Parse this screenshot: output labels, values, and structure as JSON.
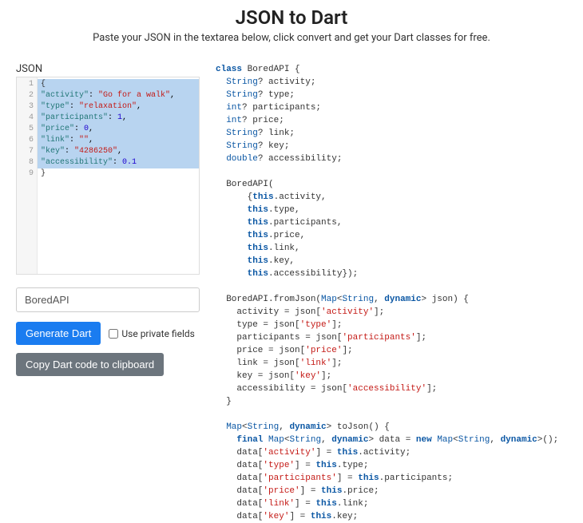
{
  "header": {
    "title": "JSON to Dart",
    "subtitle": "Paste your JSON in the textarea below, click convert and get your Dart classes for free."
  },
  "left": {
    "json_label": "JSON",
    "classname_value": "BoredAPI",
    "generate_button": "Generate Dart",
    "private_checkbox_label": "Use private fields",
    "copy_button": "Copy Dart code to clipboard",
    "editor_lines": [
      "1",
      "2",
      "3",
      "4",
      "5",
      "6",
      "7",
      "8",
      "9"
    ],
    "json_content": {
      "l1": "{",
      "l2_k": "\"activity\"",
      "l2_v": "\"Go for a walk\"",
      "l3_k": "\"type\"",
      "l3_v": "\"relaxation\"",
      "l4_k": "\"participants\"",
      "l4_v": "1",
      "l5_k": "\"price\"",
      "l5_v": "0",
      "l6_k": "\"link\"",
      "l6_v": "\"\"",
      "l7_k": "\"key\"",
      "l7_v": "\"4286250\"",
      "l8_k": "\"accessibility\"",
      "l8_v": "0.1",
      "l9": "}"
    }
  },
  "dart": {
    "class_kw": "class",
    "class_name": "BoredAPI",
    "decl1_t": "String",
    "decl1_n": "? activity;",
    "decl2_t": "String",
    "decl2_n": "? type;",
    "decl3_t": "int",
    "decl3_n": "? participants;",
    "decl4_t": "int",
    "decl4_n": "? price;",
    "decl5_t": "String",
    "decl5_n": "? link;",
    "decl6_t": "String",
    "decl6_n": "? key;",
    "decl7_t": "double",
    "decl7_n": "? accessibility;",
    "ctor_name": "BoredAPI(",
    "ctor_1": "      {",
    "ctor_this": "this",
    "ctor_f1": ".activity,",
    "ctor_f2": ".type,",
    "ctor_f3": ".participants,",
    "ctor_f4": ".price,",
    "ctor_f5": ".link,",
    "ctor_f6": ".key,",
    "ctor_f7": ".accessibility});",
    "fromjson_name": "BoredAPI.fromJson(",
    "map_t": "Map",
    "string_t": "String",
    "dynamic_kw": "dynamic",
    "fromjson_tail": "> json) {",
    "fj1a": "    activity = json[",
    "fj1b": "'activity'",
    "fj1c": "];",
    "fj2a": "    type = json[",
    "fj2b": "'type'",
    "fj2c": "];",
    "fj3a": "    participants = json[",
    "fj3b": "'participants'",
    "fj3c": "];",
    "fj4a": "    price = json[",
    "fj4b": "'price'",
    "fj4c": "];",
    "fj5a": "    link = json[",
    "fj5b": "'link'",
    "fj5c": "];",
    "fj6a": "    key = json[",
    "fj6b": "'key'",
    "fj6c": "];",
    "fj7a": "    accessibility = json[",
    "fj7b": "'accessibility'",
    "fj7c": "];",
    "close_brace": "  }",
    "tojson_head_a": "> toJson() {",
    "final_kw": "final",
    "new_kw": "new",
    "tojson_data_decl_a": "> data = ",
    "tojson_data_decl_b": ">();",
    "tj1a": "    data[",
    "tj1b": "'activity'",
    "tj1c": ".activity;",
    "tj2a": "    data[",
    "tj2b": "'type'",
    "tj2c": ".type;",
    "tj3a": "    data[",
    "tj3b": "'participants'",
    "tj3c": ".participants;",
    "tj4a": "    data[",
    "tj4b": "'price'",
    "tj4c": ".price;",
    "tj5a": "    data[",
    "tj5b": "'link'",
    "tj5c": ".link;",
    "tj6a": "    data[",
    "tj6b": "'key'",
    "tj6c": ".key;",
    "eq_this": "] = "
  }
}
